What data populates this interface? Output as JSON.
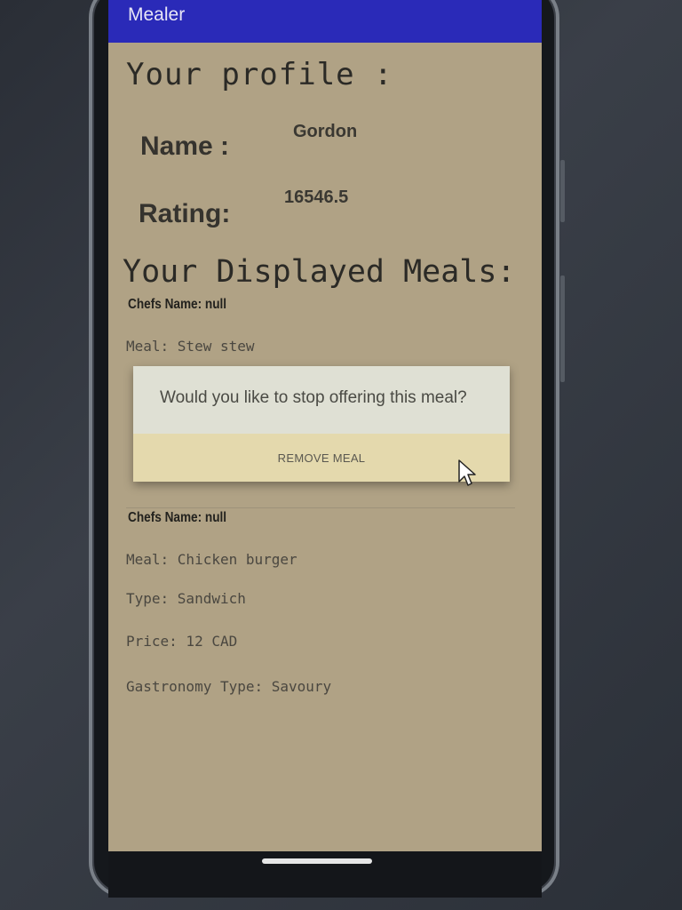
{
  "app_bar": {
    "title": "Mealer"
  },
  "profile": {
    "heading": "Your profile :",
    "name_label": "Name :",
    "name_value": "Gordon",
    "rating_label": "Rating:",
    "rating_value": "16546.5"
  },
  "meals": {
    "heading": "Your Displayed Meals:",
    "items": [
      {
        "chef": "Chefs Name: null",
        "meal": "Meal: Stew stew"
      },
      {
        "chef": "Chefs Name: null",
        "meal": "Meal: Chicken burger",
        "type": "Type: Sandwich",
        "price": "Price: 12 CAD",
        "gastronomy": "Gastronomy Type: Savoury"
      }
    ]
  },
  "dialog": {
    "message": "Would you like to stop offering this meal?",
    "button_label": "REMOVE MEAL"
  },
  "icons": {
    "cursor": "mouse-pointer-icon"
  },
  "colors": {
    "app_bar": "#2a2ab8",
    "screen_bg": "#b0a285",
    "dialog_bg": "#dfe0d4"
  }
}
